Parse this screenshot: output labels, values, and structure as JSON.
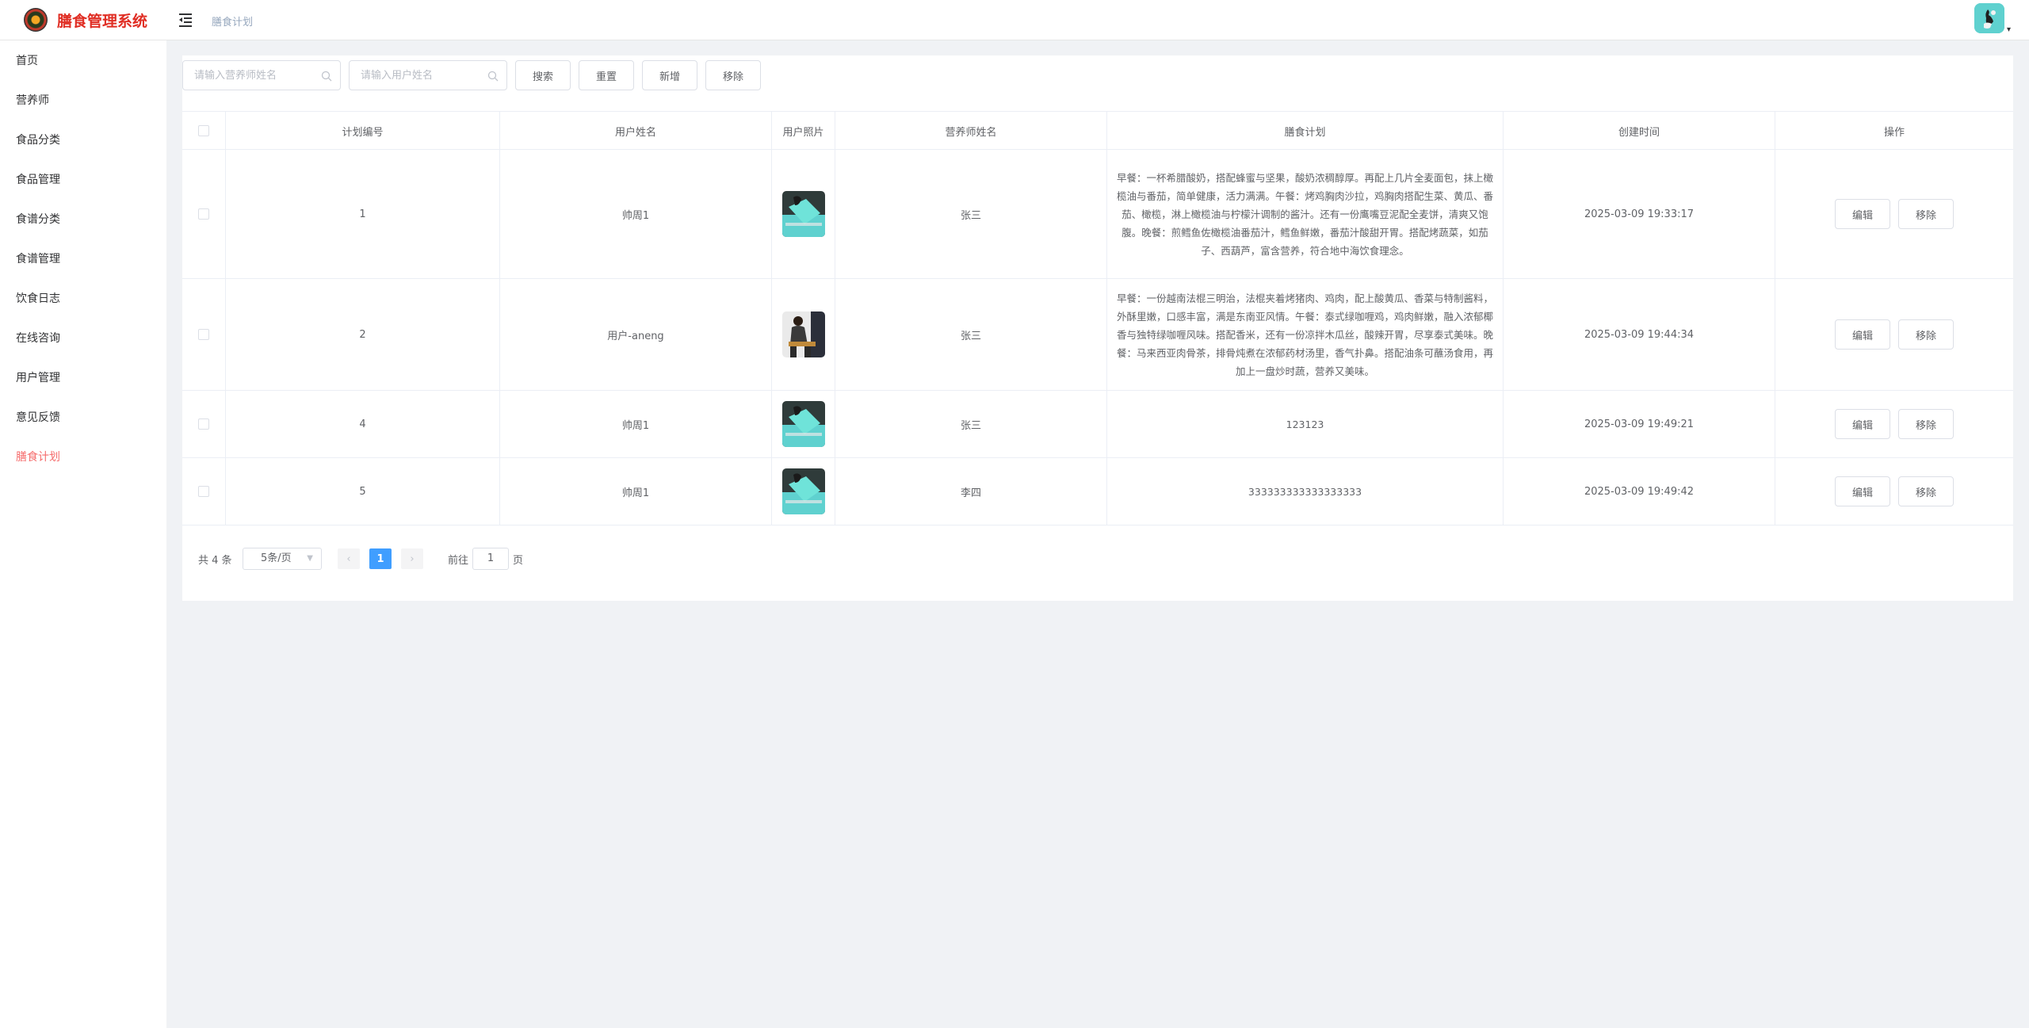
{
  "app": {
    "title": "膳食管理系统",
    "breadcrumb": "膳食计划"
  },
  "sidebar": {
    "items": [
      {
        "label": "首页"
      },
      {
        "label": "营养师"
      },
      {
        "label": "食品分类"
      },
      {
        "label": "食品管理"
      },
      {
        "label": "食谱分类"
      },
      {
        "label": "食谱管理"
      },
      {
        "label": "饮食日志"
      },
      {
        "label": "在线咨询"
      },
      {
        "label": "用户管理"
      },
      {
        "label": "意见反馈"
      },
      {
        "label": "膳食计划",
        "active": true
      }
    ]
  },
  "toolbar": {
    "dietitian_placeholder": "请输入营养师姓名",
    "user_placeholder": "请输入用户姓名",
    "search_label": "搜索",
    "reset_label": "重置",
    "add_label": "新增",
    "remove_label": "移除"
  },
  "table": {
    "columns": [
      "计划编号",
      "用户姓名",
      "用户照片",
      "营养师姓名",
      "膳食计划",
      "创建时间",
      "操作"
    ],
    "rows": [
      {
        "id": "1",
        "user": "帅周1",
        "photo": "laptop-photo",
        "dietitian": "张三",
        "plan": "早餐：一杯希腊酸奶，搭配蜂蜜与坚果，酸奶浓稠醇厚。再配上几片全麦面包，抹上橄榄油与番茄，简单健康，活力满满。午餐：烤鸡胸肉沙拉，鸡胸肉搭配生菜、黄瓜、番茄、橄榄，淋上橄榄油与柠檬汁调制的酱汁。还有一份鹰嘴豆泥配全麦饼，清爽又饱腹。晚餐：煎鳕鱼佐橄榄油番茄汁，鳕鱼鲜嫩，番茄汁酸甜开胃。搭配烤蔬菜，如茄子、西葫芦，富含营养，符合地中海饮食理念。",
        "created": "2025-03-09 19:33:17"
      },
      {
        "id": "2",
        "user": "用户-aneng",
        "photo": "person-photo",
        "dietitian": "张三",
        "plan": "早餐：一份越南法棍三明治，法棍夹着烤猪肉、鸡肉，配上酸黄瓜、香菜与特制酱料，外酥里嫩，口感丰富，满是东南亚风情。午餐：泰式绿咖喱鸡，鸡肉鲜嫩，融入浓郁椰香与独特绿咖喱风味。搭配香米，还有一份凉拌木瓜丝，酸辣开胃，尽享泰式美味。晚餐：马来西亚肉骨茶，排骨炖煮在浓郁药材汤里，香气扑鼻。搭配油条可蘸汤食用，再加上一盘炒时蔬，营养又美味。",
        "created": "2025-03-09 19:44:34"
      },
      {
        "id": "4",
        "user": "帅周1",
        "photo": "laptop-photo",
        "dietitian": "张三",
        "plan": "123123",
        "created": "2025-03-09 19:49:21"
      },
      {
        "id": "5",
        "user": "帅周1",
        "photo": "laptop-photo",
        "dietitian": "李四",
        "plan": "333333333333333333",
        "created": "2025-03-09 19:49:42"
      }
    ],
    "edit_label": "编辑",
    "remove_label": "移除"
  },
  "pagination": {
    "total": "共 4 条",
    "page_size": "5条/页",
    "current": "1",
    "goto_label": "前往",
    "goto_value": "1",
    "page_suffix": "页"
  },
  "colors": {
    "brand": "#e02e24",
    "active": "#f56c6c",
    "primary": "#409eff"
  }
}
